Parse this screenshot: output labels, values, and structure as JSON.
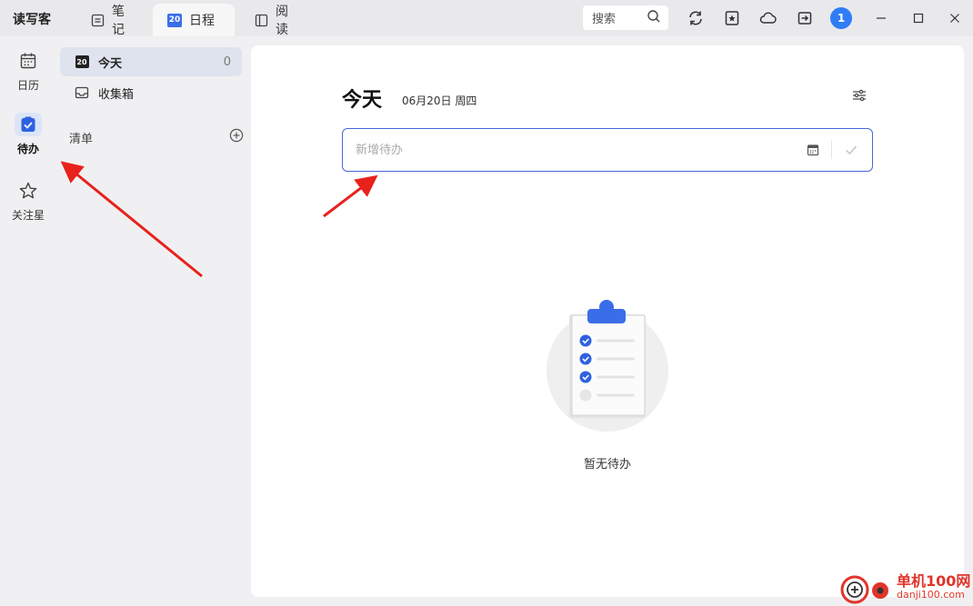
{
  "app_title": "读写客",
  "tabs": [
    {
      "label": "笔记",
      "icon": "note-icon",
      "active": false
    },
    {
      "label": "日程",
      "icon": "schedule-20-icon",
      "badge": "20",
      "active": true
    },
    {
      "label": "阅读",
      "icon": "read-icon",
      "active": false
    }
  ],
  "toolbar": {
    "search_label": "搜索",
    "avatar_label": "1",
    "accent_color": "#2f7df6"
  },
  "rail": {
    "items": [
      {
        "label": "日历",
        "icon": "calendar-icon",
        "active": false
      },
      {
        "label": "待办",
        "icon": "todo-check-icon",
        "active": true
      },
      {
        "label": "关注星",
        "icon": "star-icon",
        "active": false
      }
    ]
  },
  "list": {
    "items": [
      {
        "label": "今天",
        "badge": "20",
        "count": "0",
        "active": true
      },
      {
        "label": "收集箱",
        "icon": "inbox-icon",
        "active": false
      }
    ],
    "section_label": "清单"
  },
  "main": {
    "title": "今天",
    "date": "06月20日 周四",
    "new_todo_placeholder": "新增待办",
    "empty_text": "暂无待办"
  },
  "watermark": {
    "site_name": "单机100网",
    "site_url": "danji100.com"
  }
}
